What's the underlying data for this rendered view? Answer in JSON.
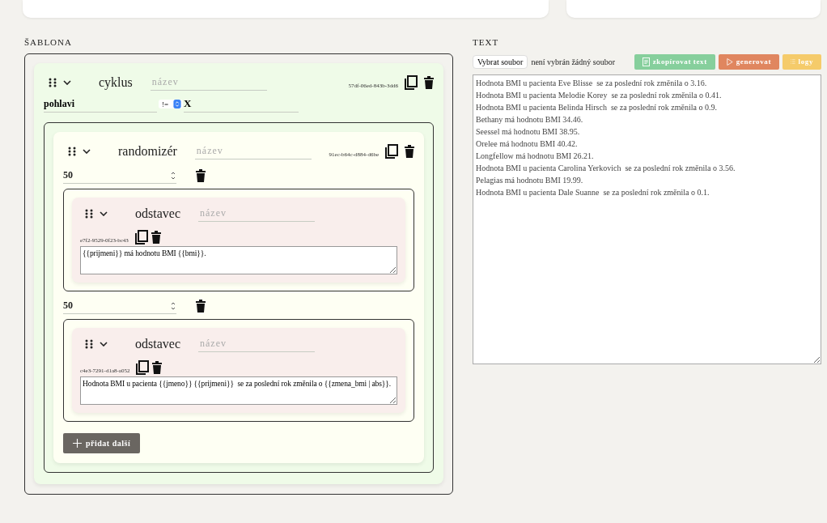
{
  "template": {
    "heading": "ŠABLONA",
    "block": {
      "kind": "cycle",
      "label": "cyklus",
      "name_placeholder": "název",
      "id": "57df-06ed-843b-3dd6",
      "condition": {
        "field": "pohlavi",
        "operator": "!=",
        "value": "X"
      },
      "children": [
        {
          "kind": "randomizer",
          "label": "randomizér",
          "name_placeholder": "název",
          "id": "91ec-b64c-d884-d6be",
          "branches": [
            {
              "weight": "50",
              "block": {
                "kind": "paragraph",
                "label": "odstavec",
                "name_placeholder": "název",
                "id": "e7f2-9529-0f23-bc43",
                "text": "{{prijmeni}} má hodnotu BMI {{bmi}}."
              }
            },
            {
              "weight": "50",
              "block": {
                "kind": "paragraph",
                "label": "odstavec",
                "name_placeholder": "název",
                "id": "c4e3-7291-d1a8-a052",
                "text": "Hodnota BMI u pacienta {{jmeno}} {{prijmeni}}  se za poslední rok změnila o {{zmena_bmi | abs}}."
              }
            }
          ],
          "add_button": "přidat další"
        }
      ]
    }
  },
  "output": {
    "heading": "TEXT",
    "file_button": "Vybrat soubor",
    "file_status": "není vybrán žádný soubor",
    "buttons": [
      {
        "kind": "copy",
        "label": "zkopírovat text",
        "color": "#86cf9c"
      },
      {
        "kind": "play",
        "label": "generovat",
        "color": "#e0865f"
      },
      {
        "kind": "list",
        "label": "logy",
        "color": "#f5cb6a"
      }
    ],
    "lines": [
      "Hodnota BMI u pacienta Eve Blisse  se za poslední rok změnila o 3.16.",
      "Hodnota BMI u pacienta Melodie Korey  se za poslední rok změnila o 0.41.",
      "Hodnota BMI u pacienta Belinda Hirsch  se za poslední rok změnila o 0.9.",
      "Bethany má hodnotu BMI 34.46.",
      "Seessel má hodnotu BMI 38.95.",
      "Orelee má hodnotu BMI 40.42.",
      "Longfellow má hodnotu BMI 26.21.",
      "Hodnota BMI u pacienta Carolina Yerkovich  se za poslední rok změnila o 3.56.",
      "Pelagias má hodnotu BMI 19.99.",
      "Hodnota BMI u pacienta Dale Suanne  se za poslední rok změnila o 0.1."
    ]
  }
}
